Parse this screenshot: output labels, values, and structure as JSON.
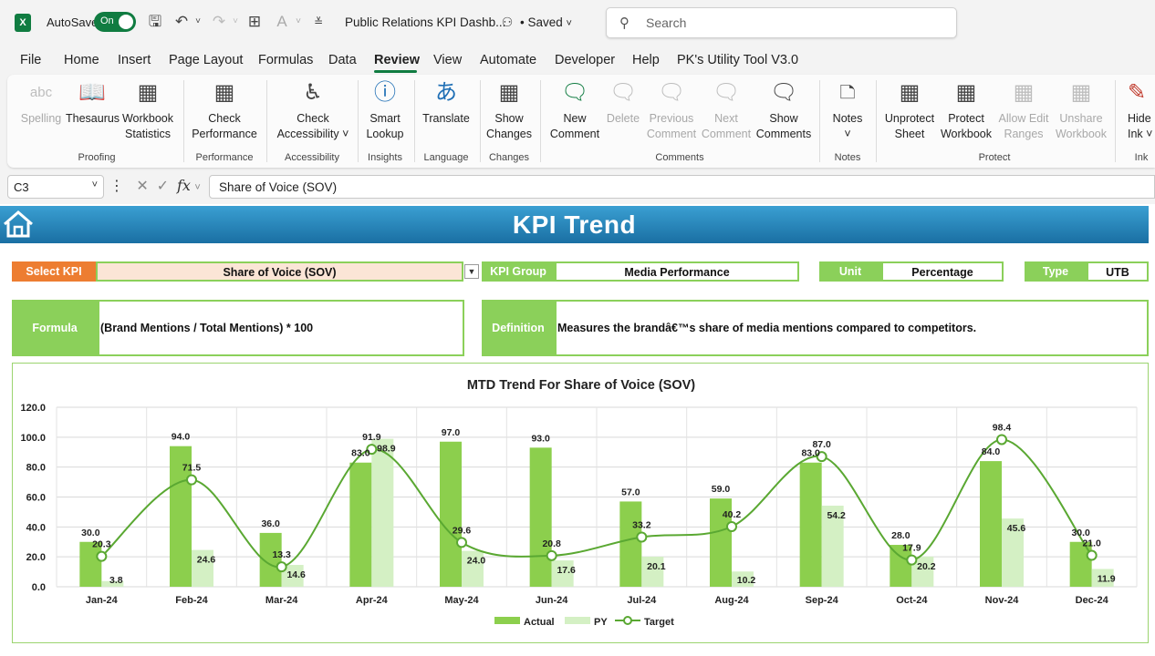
{
  "titlebar": {
    "autosave_label": "AutoSave",
    "autosave_state": "On",
    "doc_title": "Public Relations KPI Dashb...",
    "saved": "• Saved",
    "search_placeholder": "Search"
  },
  "menu": [
    "File",
    "Home",
    "Insert",
    "Page Layout",
    "Formulas",
    "Data",
    "Review",
    "View",
    "Automate",
    "Developer",
    "Help",
    "PK's Utility Tool V3.0"
  ],
  "menu_active": "Review",
  "ribbon": {
    "buttons": [
      {
        "name": "spelling",
        "line1": "Spelling",
        "line2": "",
        "disabled": true,
        "icon": "spellcheck-icon"
      },
      {
        "name": "thesaurus",
        "line1": "Thesaurus",
        "line2": "",
        "disabled": false,
        "icon": "book-icon"
      },
      {
        "name": "workbook-statistics",
        "line1": "Workbook",
        "line2": "Statistics",
        "disabled": false,
        "icon": "grid-123-icon"
      },
      {
        "name": "check-performance",
        "line1": "Check",
        "line2": "Performance",
        "disabled": false,
        "icon": "sheet-clock-icon"
      },
      {
        "name": "check-accessibility",
        "line1": "Check",
        "line2": "Accessibility ˅",
        "disabled": false,
        "icon": "accessibility-icon"
      },
      {
        "name": "smart-lookup",
        "line1": "Smart",
        "line2": "Lookup",
        "disabled": false,
        "icon": "search-info-icon"
      },
      {
        "name": "translate",
        "line1": "Translate",
        "line2": "",
        "disabled": false,
        "icon": "translate-icon"
      },
      {
        "name": "show-changes",
        "line1": "Show",
        "line2": "Changes",
        "disabled": false,
        "icon": "sheet-history-icon"
      },
      {
        "name": "new-comment",
        "line1": "New",
        "line2": "Comment",
        "disabled": false,
        "icon": "comment-plus-icon"
      },
      {
        "name": "delete-comment",
        "line1": "Delete",
        "line2": "",
        "disabled": true,
        "icon": "comment-delete-icon"
      },
      {
        "name": "previous-comment",
        "line1": "Previous",
        "line2": "Comment",
        "disabled": true,
        "icon": "comment-prev-icon"
      },
      {
        "name": "next-comment",
        "line1": "Next",
        "line2": "Comment",
        "disabled": true,
        "icon": "comment-next-icon"
      },
      {
        "name": "show-comments",
        "line1": "Show",
        "line2": "Comments",
        "disabled": false,
        "icon": "comment-icon"
      },
      {
        "name": "notes",
        "line1": "Notes",
        "line2": "˅",
        "disabled": false,
        "icon": "note-icon"
      },
      {
        "name": "unprotect-sheet",
        "line1": "Unprotect",
        "line2": "Sheet",
        "disabled": false,
        "icon": "sheet-lock-icon"
      },
      {
        "name": "protect-workbook",
        "line1": "Protect",
        "line2": "Workbook",
        "disabled": false,
        "icon": "workbook-lock-icon"
      },
      {
        "name": "allow-edit-ranges",
        "line1": "Allow Edit",
        "line2": "Ranges",
        "disabled": true,
        "icon": "edit-ranges-icon"
      },
      {
        "name": "unshare-workbook",
        "line1": "Unshare",
        "line2": "Workbook",
        "disabled": true,
        "icon": "unshare-icon"
      },
      {
        "name": "hide-ink",
        "line1": "Hide",
        "line2": "Ink ˅",
        "disabled": false,
        "icon": "ink-icon"
      }
    ],
    "groups": [
      "Proofing",
      "Performance",
      "Accessibility",
      "Insights",
      "Language",
      "Changes",
      "Comments",
      "Notes",
      "Protect",
      "Ink"
    ]
  },
  "formula_bar": {
    "cell_ref": "C3",
    "formula": "Share of Voice (SOV)"
  },
  "dashboard": {
    "title": "KPI Trend",
    "select_kpi_label": "Select KPI",
    "select_kpi_value": "Share of Voice (SOV)",
    "kpi_group_label": "KPI Group",
    "kpi_group_value": "Media Performance",
    "unit_label": "Unit",
    "unit_value": "Percentage",
    "type_label": "Type",
    "type_value": "UTB",
    "formula_label": "Formula",
    "formula_value": "(Brand Mentions / Total Mentions) * 100",
    "definition_label": "Definition",
    "definition_value": "Measures the brandâ€™s share of media mentions compared to competitors."
  },
  "colors": {
    "accent_green": "#8bd05a",
    "orange": "#ed7d31",
    "actual": "#8ccf4d",
    "py": "#d4f0c4",
    "target": "#5aa832",
    "banner": "#2a85bd"
  },
  "chart_data": {
    "type": "bar",
    "title": "MTD Trend For Share of Voice (SOV)",
    "categories": [
      "Jan-24",
      "Feb-24",
      "Mar-24",
      "Apr-24",
      "May-24",
      "Jun-24",
      "Jul-24",
      "Aug-24",
      "Sep-24",
      "Oct-24",
      "Nov-24",
      "Dec-24"
    ],
    "series": [
      {
        "name": "Actual",
        "type": "bar",
        "values": [
          30.0,
          94.0,
          36.0,
          83.0,
          97.0,
          93.0,
          57.0,
          59.0,
          83.0,
          28.0,
          84.0,
          30.0
        ]
      },
      {
        "name": "PY",
        "type": "bar",
        "values": [
          3.8,
          24.6,
          14.6,
          98.9,
          24.0,
          17.6,
          20.1,
          10.2,
          54.2,
          20.2,
          45.6,
          11.9
        ]
      },
      {
        "name": "Target",
        "type": "line",
        "values": [
          20.3,
          71.5,
          13.3,
          91.9,
          29.6,
          20.8,
          33.2,
          40.2,
          87.0,
          17.9,
          98.4,
          21.0
        ]
      }
    ],
    "yticks": [
      "0.0",
      "20.0",
      "40.0",
      "60.0",
      "80.0",
      "100.0",
      "120.0"
    ],
    "ylim": [
      0,
      120
    ],
    "grid": true,
    "legend": "bottom"
  }
}
